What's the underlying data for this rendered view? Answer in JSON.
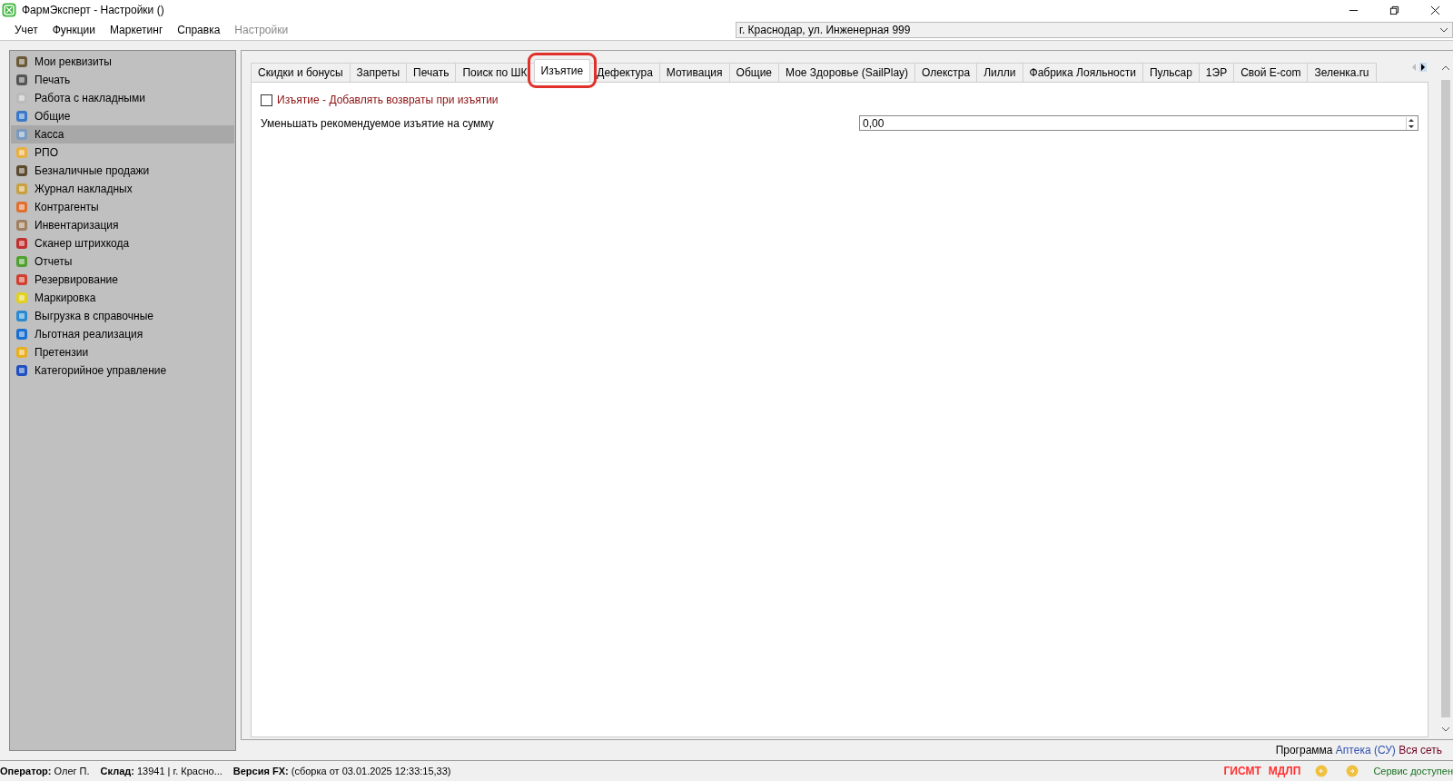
{
  "window": {
    "title": "ФармЭксперт - Настройки ()"
  },
  "menu": [
    {
      "label": "Учет",
      "disabled": false
    },
    {
      "label": "Функции",
      "disabled": false
    },
    {
      "label": "Маркетинг",
      "disabled": false
    },
    {
      "label": "Справка",
      "disabled": false
    },
    {
      "label": "Настройки",
      "disabled": true
    }
  ],
  "location": {
    "value": "г. Краснодар, ул. Инженерная 999"
  },
  "sidebar": {
    "items": [
      {
        "label": "Мои реквизиты",
        "selected": false
      },
      {
        "label": "Печать",
        "selected": false
      },
      {
        "label": "Работа с накладными",
        "selected": false
      },
      {
        "label": "Общие",
        "selected": false
      },
      {
        "label": "Касса",
        "selected": true
      },
      {
        "label": "РПО",
        "selected": false
      },
      {
        "label": "Безналичные продажи",
        "selected": false
      },
      {
        "label": "Журнал накладных",
        "selected": false
      },
      {
        "label": "Контрагенты",
        "selected": false
      },
      {
        "label": "Инвентаризация",
        "selected": false
      },
      {
        "label": "Сканер штрихкода",
        "selected": false
      },
      {
        "label": "Отчеты",
        "selected": false
      },
      {
        "label": "Резервирование",
        "selected": false
      },
      {
        "label": "Маркировка",
        "selected": false
      },
      {
        "label": "Выгрузка в справочные",
        "selected": false
      },
      {
        "label": "Льготная реализация",
        "selected": false
      },
      {
        "label": "Претензии",
        "selected": false
      },
      {
        "label": "Категорийное управление",
        "selected": false
      }
    ]
  },
  "tabs": [
    {
      "label": "Скидки и бонусы",
      "selected": false,
      "highlighted": false
    },
    {
      "label": "Запреты",
      "selected": false,
      "highlighted": false
    },
    {
      "label": "Печать",
      "selected": false,
      "highlighted": false
    },
    {
      "label": "Поиск по ШК",
      "selected": false,
      "highlighted": false
    },
    {
      "label": "Изъятие",
      "selected": true,
      "highlighted": true
    },
    {
      "label": "Дефектура",
      "selected": false,
      "highlighted": false
    },
    {
      "label": "Мотивация",
      "selected": false,
      "highlighted": false
    },
    {
      "label": "Общие",
      "selected": false,
      "highlighted": false
    },
    {
      "label": "Мое Здоровье (SailPlay)",
      "selected": false,
      "highlighted": false
    },
    {
      "label": "Олекстра",
      "selected": false,
      "highlighted": false
    },
    {
      "label": "Лилли",
      "selected": false,
      "highlighted": false
    },
    {
      "label": "Фабрика Лояльности",
      "selected": false,
      "highlighted": false
    },
    {
      "label": "Пульсар",
      "selected": false,
      "highlighted": false
    },
    {
      "label": "1ЭР",
      "selected": false,
      "highlighted": false
    },
    {
      "label": "Свой E-com",
      "selected": false,
      "highlighted": false
    },
    {
      "label": "Зеленка.ru",
      "selected": false,
      "highlighted": false
    }
  ],
  "settings": {
    "checkbox": {
      "label": "Изъятие - Добавлять возвраты при изъятии",
      "checked": false
    },
    "amount": {
      "label": "Уменьшать рекомендуемое изъятие на сумму",
      "value": "0,00"
    }
  },
  "program_line": {
    "label": "Программа",
    "product": "Аптека (СУ)",
    "scope": "Вся сеть"
  },
  "status_bar": {
    "operator_label": "Оператор:",
    "operator": "Олег П.",
    "store_label": "Склад:",
    "store": "13941 | г. Красно...",
    "version_label": "Версия FX:",
    "version": "(сборка от 03.01.2025 12:33:15,33)",
    "badges": [
      "ГИСМТ",
      "МДЛП"
    ],
    "service": "Сервис доступен"
  }
}
